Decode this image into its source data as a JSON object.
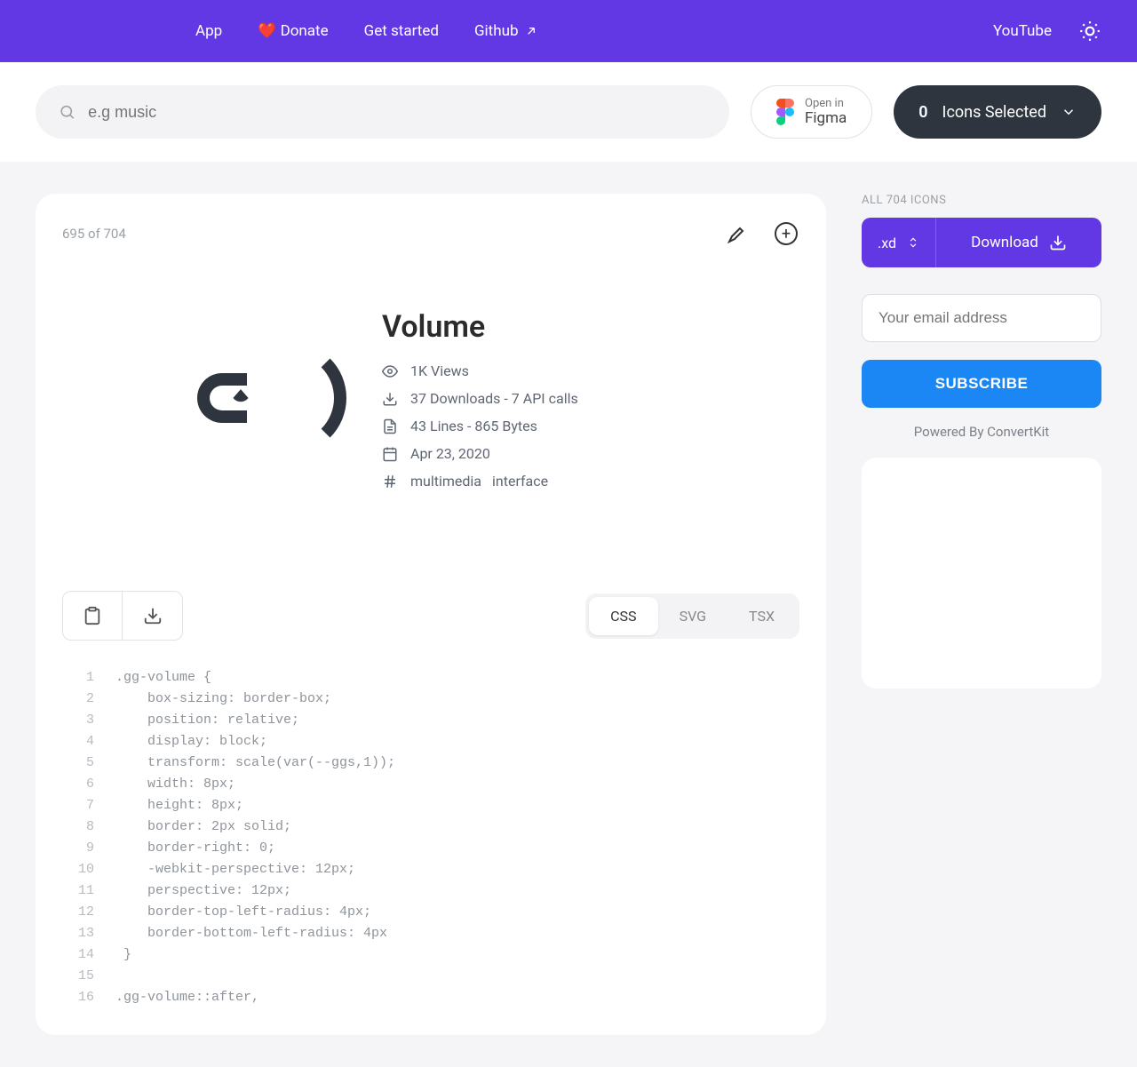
{
  "nav": {
    "app": "App",
    "donate": "❤️ Donate",
    "get_started": "Get started",
    "github": "Github",
    "youtube": "YouTube"
  },
  "search": {
    "placeholder": "e.g music"
  },
  "figma": {
    "open_in": "Open in",
    "label": "Figma"
  },
  "selected": {
    "count": "0",
    "label": "Icons Selected"
  },
  "icon": {
    "position": "695 of 704",
    "name": "Volume",
    "views": "1K Views",
    "downloads": "37 Downloads - 7 API calls",
    "stats": "43 Lines - 865 Bytes",
    "date": "Apr 23, 2020",
    "tags": [
      "multimedia",
      "interface"
    ]
  },
  "code": {
    "tabs": {
      "css": "CSS",
      "svg": "SVG",
      "tsx": "TSX"
    },
    "lines": [
      ".gg-volume {",
      "    box-sizing: border-box;",
      "    position: relative;",
      "    display: block;",
      "    transform: scale(var(--ggs,1));",
      "    width: 8px;",
      "    height: 8px;",
      "    border: 2px solid;",
      "    border-right: 0;",
      "    -webkit-perspective: 12px;",
      "    perspective: 12px;",
      "    border-top-left-radius: 4px;",
      "    border-bottom-left-radius: 4px",
      " }",
      "",
      ".gg-volume::after,"
    ]
  },
  "sidebar": {
    "all_label": "ALL 704 ICONS",
    "format": ".xd",
    "download": "Download",
    "email_placeholder": "Your email address",
    "subscribe": "SUBSCRIBE",
    "powered": "Powered By ConvertKit"
  }
}
